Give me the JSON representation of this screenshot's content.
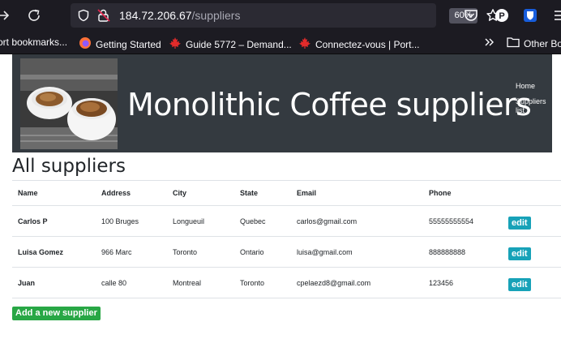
{
  "browser": {
    "url_host": "184.72.206.67",
    "url_path": "/suppliers",
    "zoom": "60%",
    "ext_p_label": "P",
    "bookmarks": [
      {
        "label": "ort bookmarks...",
        "icon": "none"
      },
      {
        "label": "Getting Started",
        "icon": "firefox-icon"
      },
      {
        "label": "Guide 5772 – Demand...",
        "icon": "maple-leaf-icon"
      },
      {
        "label": "Connectez-vous | Port...",
        "icon": "maple-leaf-icon"
      }
    ],
    "other_bookmarks": "Other Bo"
  },
  "header": {
    "title": "Monolithic Coffee suppliers",
    "nav": [
      {
        "label": "Home"
      },
      {
        "label": "Suppliers list"
      }
    ]
  },
  "main": {
    "heading": "All suppliers",
    "columns": [
      "Name",
      "Address",
      "City",
      "State",
      "Email",
      "Phone"
    ],
    "rows": [
      {
        "name": "Carlos P",
        "address": "100 Bruges",
        "city": "Longueuil",
        "state": "Quebec",
        "email": "carlos@gmail.com",
        "phone": "55555555554",
        "action": "edit"
      },
      {
        "name": "Luisa Gomez",
        "address": "966 Marc",
        "city": "Toronto",
        "state": "Ontario",
        "email": "luisa@gmail.com",
        "phone": "888888888",
        "action": "edit"
      },
      {
        "name": "Juan",
        "address": "calle 80",
        "city": "Montreal",
        "state": "Toronto",
        "email": "cpelaezd8@gmail.com",
        "phone": "123456",
        "action": "edit"
      }
    ],
    "add_button": "Add a new supplier"
  },
  "colors": {
    "header_bg": "#343a40",
    "edit_button": "#17a2b8",
    "add_button": "#28a745",
    "browser_bg": "#1c1b22"
  }
}
